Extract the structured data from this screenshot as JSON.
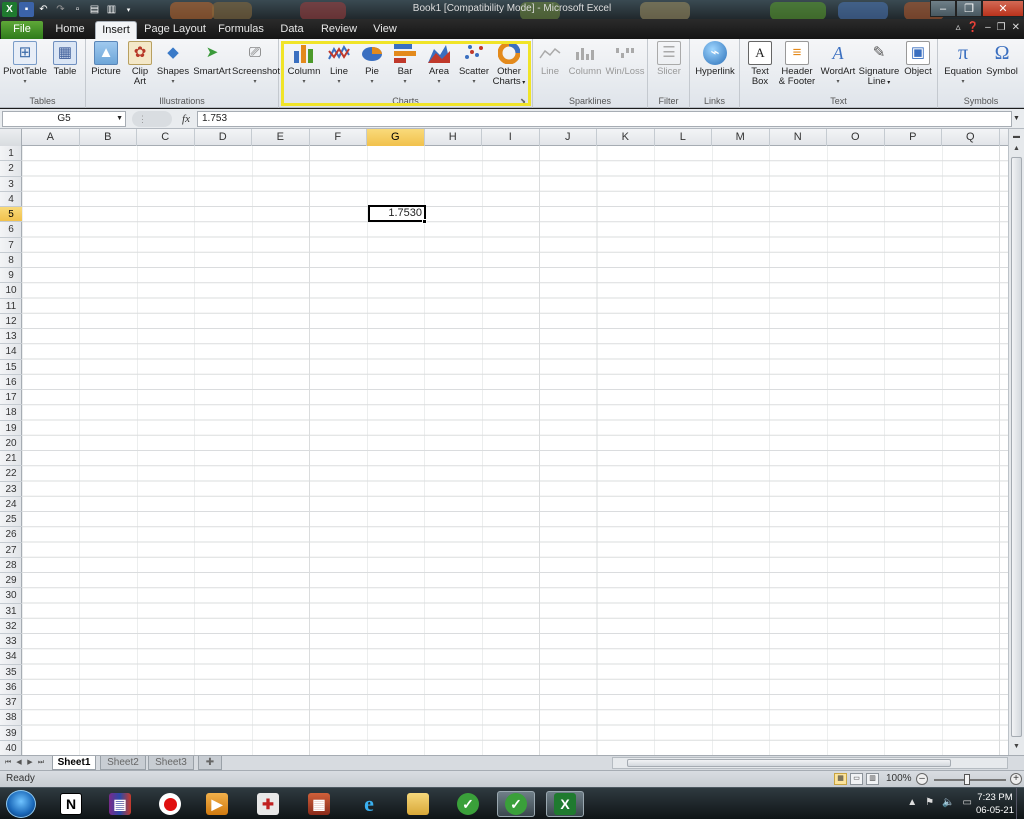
{
  "window": {
    "title": "Book1  [Compatibility Mode]  -  Microsoft Excel"
  },
  "tabs": [
    "File",
    "Home",
    "Insert",
    "Page Layout",
    "Formulas",
    "Data",
    "Review",
    "View"
  ],
  "active_tab": "Insert",
  "ribbon": {
    "groups": {
      "tables": "Tables",
      "illustrations": "Illustrations",
      "charts": "Charts",
      "sparklines": "Sparklines",
      "filter": "Filter",
      "links": "Links",
      "text": "Text",
      "symbols": "Symbols"
    },
    "buttons": {
      "pivottable": "PivotTable",
      "table": "Table",
      "picture": "Picture",
      "clipart_1": "Clip",
      "clipart_2": "Art",
      "shapes": "Shapes",
      "smartart": "SmartArt",
      "screenshot": "Screenshot",
      "column": "Column",
      "line": "Line",
      "pie": "Pie",
      "bar": "Bar",
      "area": "Area",
      "scatter": "Scatter",
      "othercharts_1": "Other",
      "othercharts_2": "Charts",
      "spark_line": "Line",
      "spark_column": "Column",
      "spark_winloss": "Win/Loss",
      "slicer": "Slicer",
      "hyperlink": "Hyperlink",
      "textbox_1": "Text",
      "textbox_2": "Box",
      "header_1": "Header",
      "header_2": "& Footer",
      "wordart": "WordArt",
      "sigline_1": "Signature",
      "sigline_2": "Line",
      "object": "Object",
      "equation": "Equation",
      "symbol": "Symbol"
    },
    "highlight_color": "#f0e428"
  },
  "formula_bar": {
    "name_box": "G5",
    "fx": "fx",
    "formula": "1.753"
  },
  "grid": {
    "columns": [
      "A",
      "B",
      "C",
      "D",
      "E",
      "F",
      "G",
      "H",
      "I",
      "J",
      "K",
      "L",
      "M",
      "N",
      "O",
      "P",
      "Q"
    ],
    "rows": [
      "1",
      "2",
      "3",
      "4",
      "5",
      "6",
      "7",
      "8",
      "9",
      "10",
      "11",
      "12",
      "13",
      "14",
      "15",
      "16",
      "17",
      "18",
      "19",
      "20",
      "21",
      "22",
      "23",
      "24",
      "25",
      "26",
      "27",
      "28",
      "29",
      "30",
      "31",
      "32",
      "33",
      "34",
      "35",
      "36",
      "37",
      "38",
      "39",
      "40"
    ],
    "selected_column": "G",
    "selected_row": "5",
    "active_cell_value": "1.7530"
  },
  "sheets": [
    "Sheet1",
    "Sheet2",
    "Sheet3"
  ],
  "active_sheet": "Sheet1",
  "status": {
    "mode": "Ready",
    "zoom": "100%"
  },
  "taskbar": {
    "time": "7:23 PM",
    "date": "06-05-21"
  }
}
